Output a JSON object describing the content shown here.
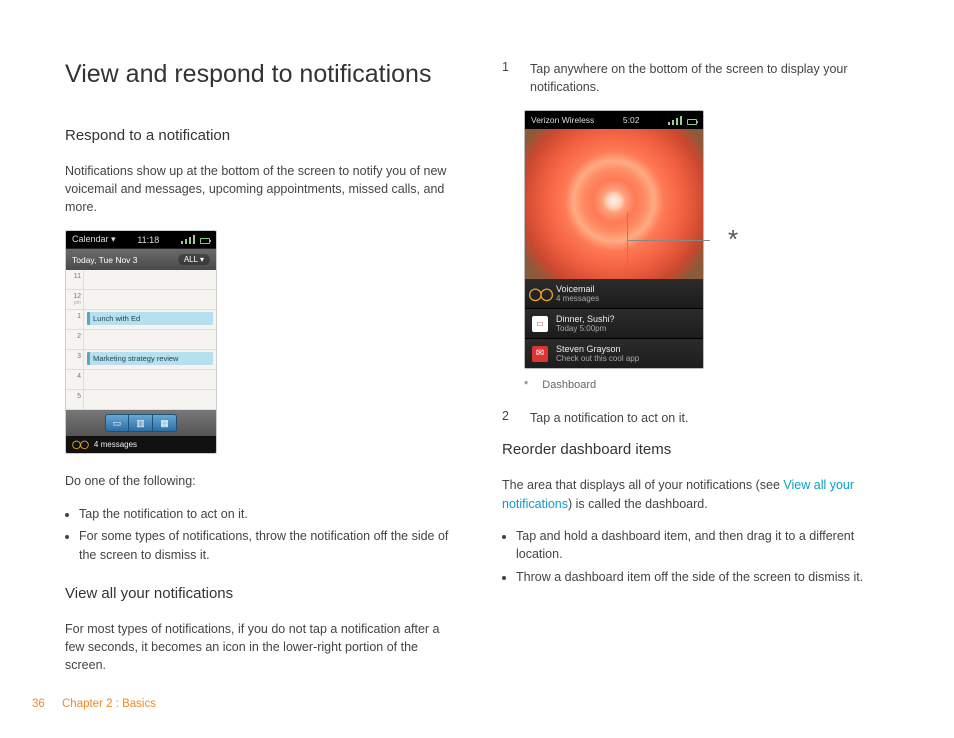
{
  "title": "View and respond to notifications",
  "left": {
    "h2a": "Respond to a notification",
    "p1": "Notifications show up at the bottom of the screen to notify you of new voicemail and messages, upcoming appointments, missed calls, and more.",
    "phone1": {
      "status_left": "Calendar",
      "status_time": "11:18",
      "sub_left": "Today, Tue Nov 3",
      "sub_right": "ALL ▾",
      "hours": [
        "11",
        "12",
        "1",
        "2",
        "3",
        "4",
        "5"
      ],
      "ev1": "Lunch with Ed",
      "ev2": "Marketing strategy review",
      "notif": "4 messages"
    },
    "p2": "Do one of the following:",
    "bullets_a": [
      "Tap the notification to act on it.",
      "For some types of notifications, throw the notification off the side of the screen to dismiss it."
    ],
    "h2b": "View all your notifications",
    "p3": "For most types of notifications, if you do not tap a notification after a few seconds, it becomes an icon in the lower-right portion of the screen."
  },
  "right": {
    "step1_num": "1",
    "step1_txt": "Tap anywhere on the bottom of the screen to display your notifications.",
    "phone2": {
      "status_left": "Verizon Wireless",
      "status_time": "5:02",
      "items": [
        {
          "icon": "vm",
          "title": "Voicemail",
          "sub": "4 messages"
        },
        {
          "icon": "cal",
          "title": "Dinner, Sushi?",
          "sub": "Today 5:00pm"
        },
        {
          "icon": "mail",
          "title": "Steven Grayson",
          "sub": "Check out this cool app"
        }
      ],
      "callout": "*"
    },
    "footnote_sym": "*",
    "footnote_txt": "Dashboard",
    "step2_num": "2",
    "step2_txt": "Tap a notification to act on it.",
    "h2c": "Reorder dashboard items",
    "p4a": "The area that displays all of your notifications (see ",
    "p4link": "View all your notifications",
    "p4b": ") is called the dashboard.",
    "bullets_b": [
      "Tap and hold a dashboard item, and then drag it to a different location.",
      "Throw a dashboard item off the side of the screen to dismiss it."
    ]
  },
  "footer": {
    "page": "36",
    "chapter": "Chapter 2 : Basics"
  }
}
